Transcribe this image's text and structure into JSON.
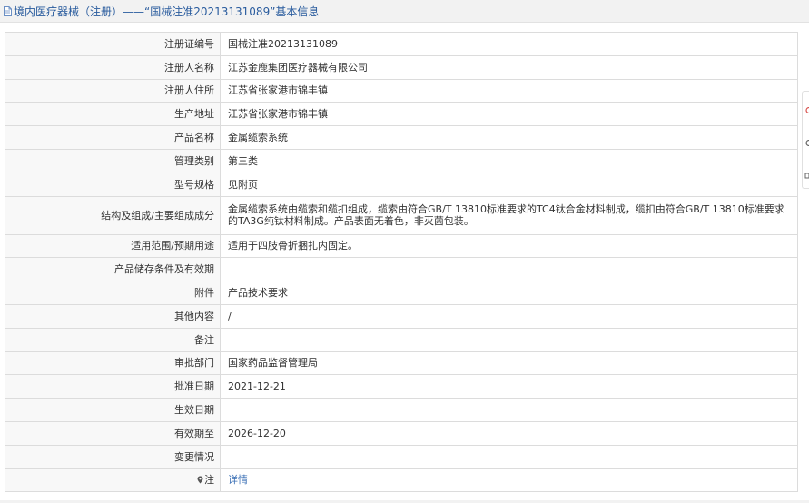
{
  "header": {
    "title": "境内医疗器械（注册）——“国械注准20213131089”基本信息"
  },
  "colors": {
    "title": "#2a5c9e",
    "link": "#3a6fb5",
    "border": "#dcdcdc",
    "header_bg": "#f2f2f2"
  },
  "rows": [
    {
      "label": "注册证编号",
      "value": "国械注准20213131089"
    },
    {
      "label": "注册人名称",
      "value": "江苏金鹿集团医疗器械有限公司"
    },
    {
      "label": "注册人住所",
      "value": "江苏省张家港市锦丰镇"
    },
    {
      "label": "生产地址",
      "value": "江苏省张家港市锦丰镇"
    },
    {
      "label": "产品名称",
      "value": "金属缆索系统"
    },
    {
      "label": "管理类别",
      "value": "第三类"
    },
    {
      "label": "型号规格",
      "value": "见附页"
    },
    {
      "label": "结构及组成/主要组成成分",
      "value": "金属缆索系统由缆索和缆扣组成，缆索由符合GB/T 13810标准要求的TC4钛合金材料制成，缆扣由符合GB/T 13810标准要求的TA3G纯钛材料制成。产品表面无着色，非灭菌包装。"
    },
    {
      "label": "适用范围/预期用途",
      "value": "适用于四肢骨折捆扎内固定。"
    },
    {
      "label": "产品储存条件及有效期",
      "value": ""
    },
    {
      "label": "附件",
      "value": "产品技术要求"
    },
    {
      "label": "其他内容",
      "value": "/"
    },
    {
      "label": "备注",
      "value": ""
    },
    {
      "label": "审批部门",
      "value": "国家药品监督管理局"
    },
    {
      "label": "批准日期",
      "value": "2021-12-21"
    },
    {
      "label": "生效日期",
      "value": ""
    },
    {
      "label": "有效期至",
      "value": "2026-12-20"
    },
    {
      "label": "变更情况",
      "value": ""
    },
    {
      "label": "注",
      "value": "详情",
      "icon": "pin-icon"
    }
  ]
}
